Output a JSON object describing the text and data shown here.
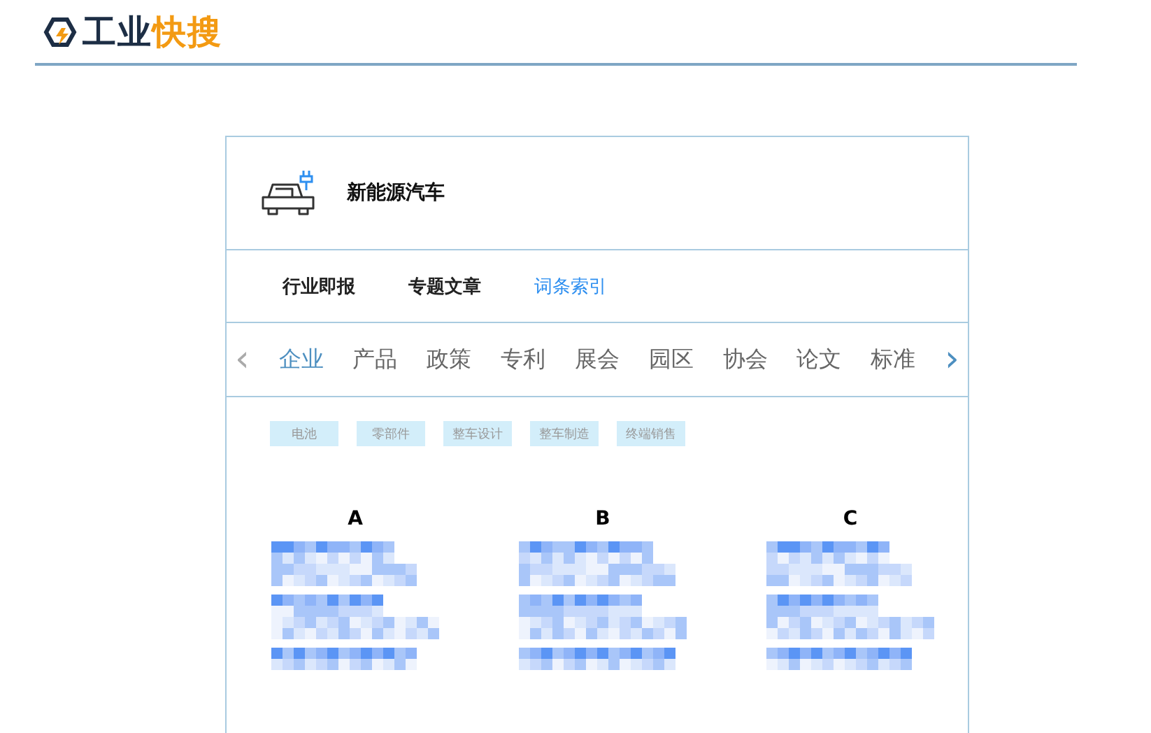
{
  "logo": {
    "parts": [
      {
        "text": "工业",
        "accent": false
      },
      {
        "text": "快搜",
        "accent": true
      }
    ]
  },
  "topic": {
    "title": "新能源汽车"
  },
  "tabs": [
    {
      "label": "行业即报",
      "selected": false
    },
    {
      "label": "专题文章",
      "selected": false
    },
    {
      "label": "词条索引",
      "selected": true
    }
  ],
  "categories": [
    {
      "label": "企业",
      "selected": true
    },
    {
      "label": "产品",
      "selected": false
    },
    {
      "label": "政策",
      "selected": false
    },
    {
      "label": "专利",
      "selected": false
    },
    {
      "label": "展会",
      "selected": false
    },
    {
      "label": "园区",
      "selected": false
    },
    {
      "label": "协会",
      "selected": false
    },
    {
      "label": "论文",
      "selected": false
    },
    {
      "label": "标准",
      "selected": false
    }
  ],
  "prev_arrow": "‹",
  "next_arrow": "›",
  "tags": [
    "电池",
    "零部件",
    "整车设计",
    "整车制造",
    "终端销售"
  ],
  "columns": [
    {
      "letter": "A"
    },
    {
      "letter": "B"
    },
    {
      "letter": "C"
    }
  ]
}
